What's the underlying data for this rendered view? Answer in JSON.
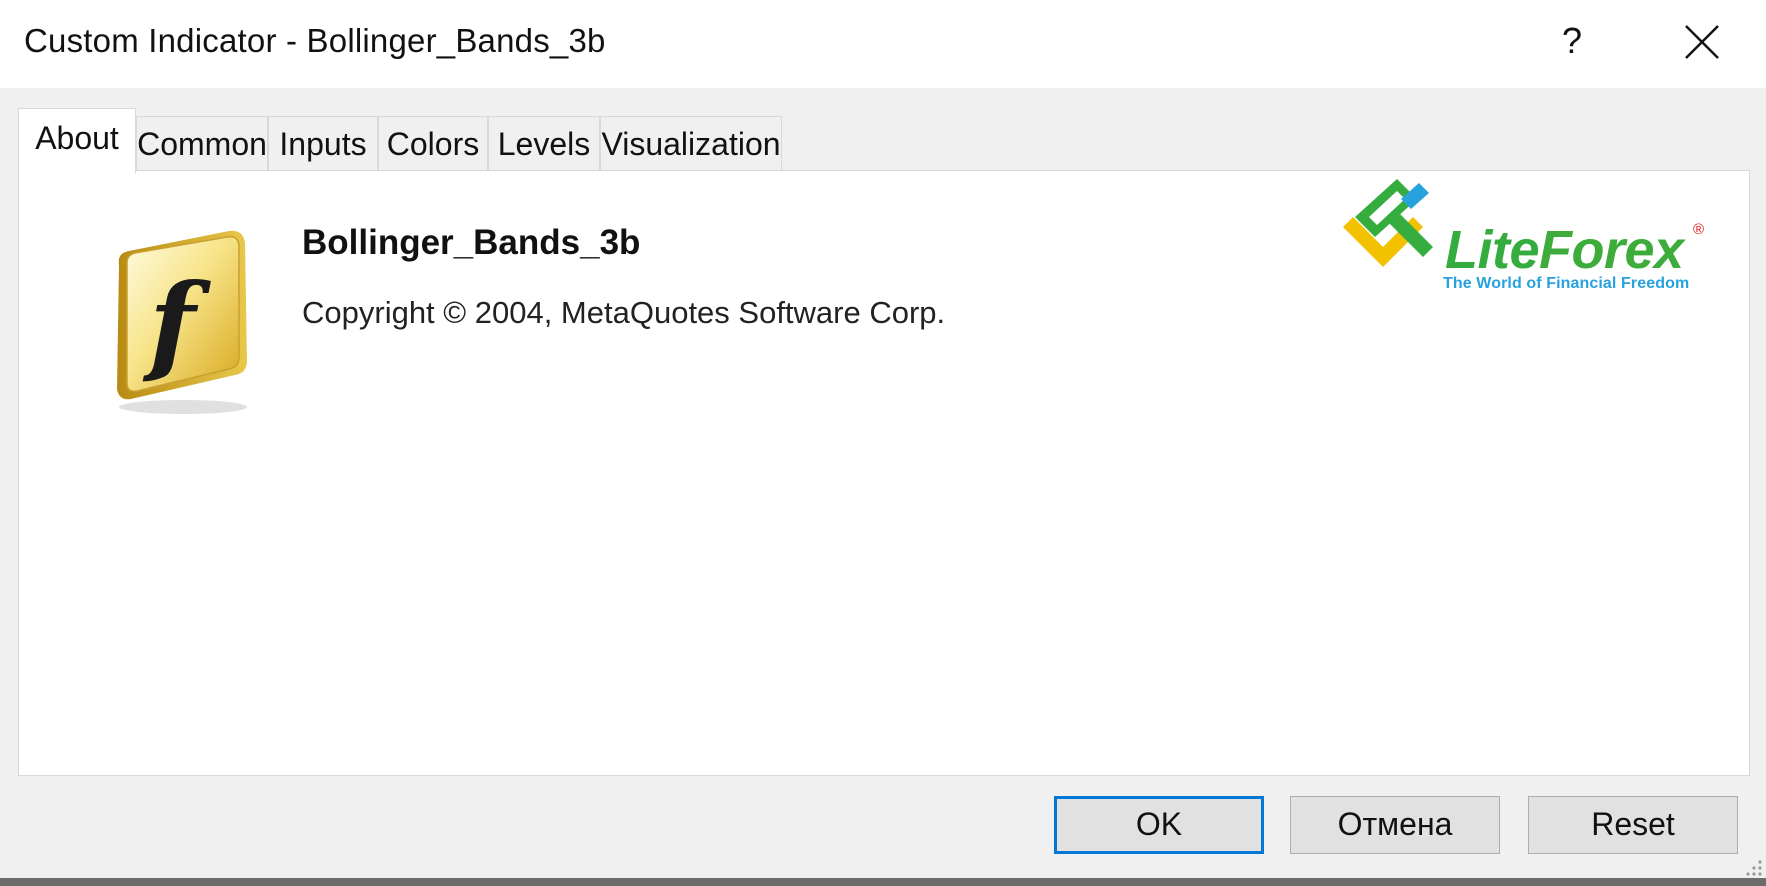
{
  "window": {
    "title": "Custom Indicator - Bollinger_Bands_3b",
    "help_label": "?",
    "close_icon": "close-icon"
  },
  "tabs": [
    {
      "label": "About",
      "active": true
    },
    {
      "label": "Common",
      "active": false
    },
    {
      "label": "Inputs",
      "active": false
    },
    {
      "label": "Colors",
      "active": false
    },
    {
      "label": "Levels",
      "active": false
    },
    {
      "label": "Visualization",
      "active": false
    }
  ],
  "about": {
    "icon": "function-f-icon",
    "indicator_name": "Bollinger_Bands_3b",
    "copyright": "Copyright © 2004, MetaQuotes Software Corp."
  },
  "logo": {
    "word_part1": "Lite",
    "word_part2": "Forex",
    "registered": "®",
    "tagline": "The World of Financial Freedom",
    "colors": {
      "green": "#34ad3e",
      "yellow": "#f2c200",
      "blue": "#27a2dc",
      "red": "#e2141c"
    }
  },
  "buttons": {
    "ok": "OK",
    "cancel": "Отмена",
    "reset": "Reset"
  },
  "colors": {
    "dialog_bg": "#f0f0f0",
    "panel_bg": "#ffffff",
    "default_button_border": "#0078d7"
  }
}
